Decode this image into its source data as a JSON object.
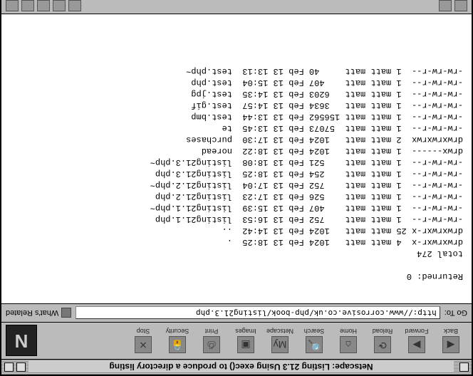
{
  "window": {
    "title": "Netscape: Listing 21.3 Using exec() to produce a directory listing"
  },
  "toolbar": {
    "back": "Back",
    "forward": "Forward",
    "reload": "Reload",
    "home": "Home",
    "search": "Search",
    "netscape": "Netscape",
    "images": "Images",
    "print": "Print",
    "security": "Security",
    "stop": "Stop",
    "logo": "N"
  },
  "location": {
    "label": "Go To:",
    "url": "http://www.corrosive.co.uk/php-book/listing21.3.php",
    "related": "What's Related"
  },
  "output": {
    "returned_label": "Returned:",
    "returned_value": "0",
    "total_label": "total",
    "total_value": "274",
    "rows": [
      {
        "perm": "drwxrwxr-x",
        "n": "4",
        "u": "matt",
        "g": "matt",
        "size": "1024",
        "date": "Feb 13 18:25",
        "name": "."
      },
      {
        "perm": "drwxrwxr-x",
        "n": "25",
        "u": "matt",
        "g": "matt",
        "size": "1024",
        "date": "Feb 13 14:42",
        "name": ".."
      },
      {
        "perm": "-rw-rw-r--",
        "n": "1",
        "u": "matt",
        "g": "matt",
        "size": "752",
        "date": "Feb 13 16:53",
        "name": "listing21.1.php"
      },
      {
        "perm": "-rw-rw-r--",
        "n": "1",
        "u": "matt",
        "g": "matt",
        "size": "407",
        "date": "Feb 13 15:39",
        "name": "listing21.1.php~"
      },
      {
        "perm": "-rw-rw-r--",
        "n": "1",
        "u": "matt",
        "g": "matt",
        "size": "526",
        "date": "Feb 13 17:23",
        "name": "listing21.2.php"
      },
      {
        "perm": "-rw-rw-r--",
        "n": "1",
        "u": "matt",
        "g": "matt",
        "size": "752",
        "date": "Feb 13 17:04",
        "name": "listing21.2.php~"
      },
      {
        "perm": "-rw-rw-r--",
        "n": "1",
        "u": "matt",
        "g": "matt",
        "size": "254",
        "date": "Feb 13 18:25",
        "name": "listing21.3.php"
      },
      {
        "perm": "-rw-rw-r--",
        "n": "1",
        "u": "matt",
        "g": "matt",
        "size": "521",
        "date": "Feb 13 18:08",
        "name": "listing21.3.php~"
      },
      {
        "perm": "drwx------",
        "n": "1",
        "u": "matt",
        "g": "matt",
        "size": "1024",
        "date": "Feb 13 18:22",
        "name": "noread"
      },
      {
        "perm": "drwxrwxrwx",
        "n": "2",
        "u": "matt",
        "g": "matt",
        "size": "1024",
        "date": "Feb 13 17:30",
        "name": "purchases"
      },
      {
        "perm": "-rw-rw-r--",
        "n": "1",
        "u": "matt",
        "g": "matt",
        "size": "57073",
        "date": "Feb 13 13:45",
        "name": "te"
      },
      {
        "perm": "-rw-rw-r--",
        "n": "1",
        "u": "matt",
        "g": "matt",
        "size": "156562",
        "date": "Feb 13 13:44",
        "name": "test.bmp"
      },
      {
        "perm": "-rw-rw-r--",
        "n": "1",
        "u": "matt",
        "g": "matt",
        "size": "3634",
        "date": "Feb 13 14:57",
        "name": "test.gif"
      },
      {
        "perm": "-rw-rw-r--",
        "n": "1",
        "u": "matt",
        "g": "matt",
        "size": "6203",
        "date": "Feb 13 14:35",
        "name": "test.jpg"
      },
      {
        "perm": "-rw-rw-r--",
        "n": "1",
        "u": "matt",
        "g": "matt",
        "size": "407",
        "date": "Feb 13 15:04",
        "name": "test.php"
      },
      {
        "perm": "-rw-rw-r--",
        "n": "1",
        "u": "matt",
        "g": "matt",
        "size": "40",
        "date": "Feb 13 13:13",
        "name": "test.php~"
      }
    ]
  }
}
